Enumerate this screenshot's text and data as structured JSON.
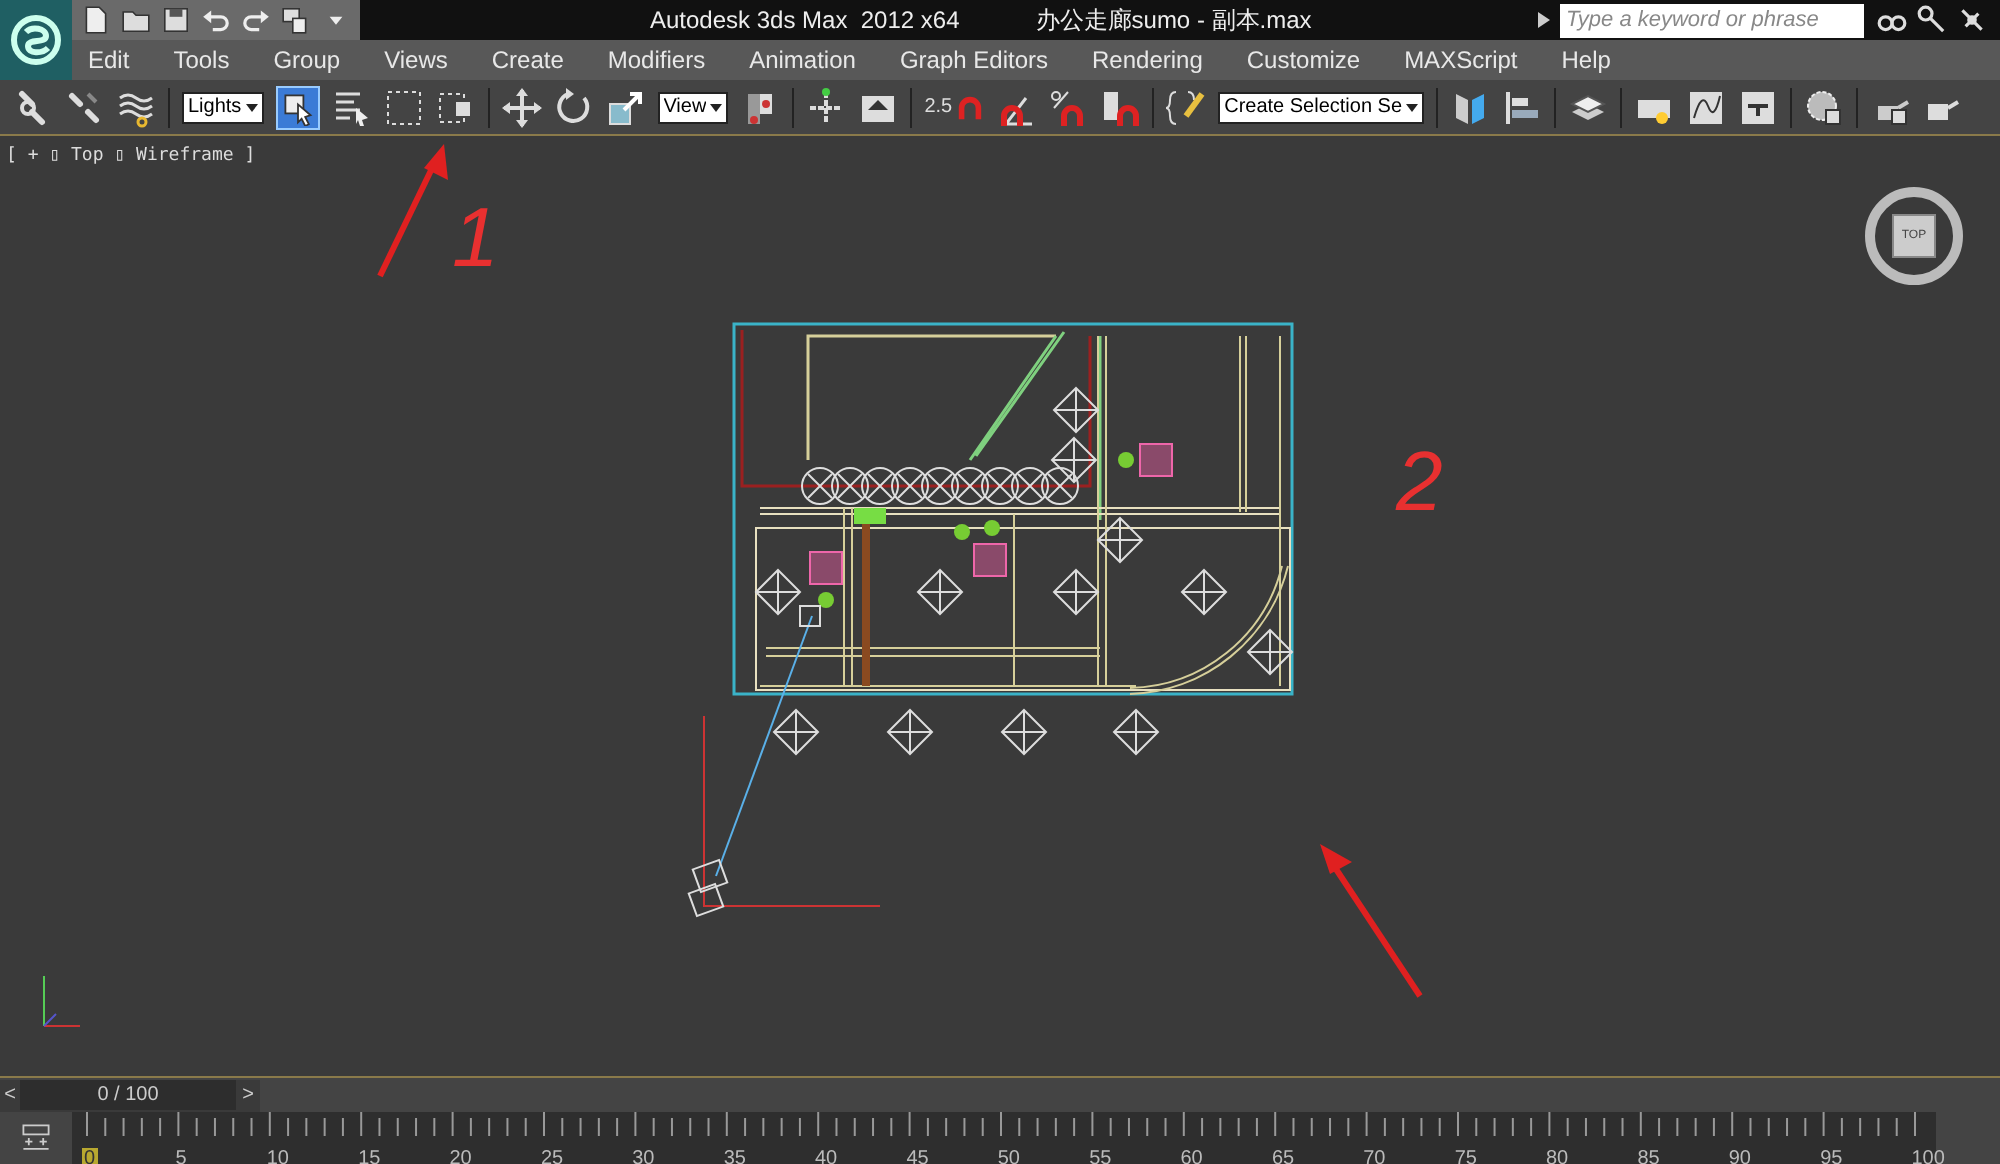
{
  "title_bar": {
    "app_title": "Autodesk 3ds Max  2012 x64",
    "file_name": "办公走廊sumo - 副本.max",
    "search": {
      "placeholder": "Type a keyword or phrase"
    }
  },
  "menu": [
    "Edit",
    "Tools",
    "Group",
    "Views",
    "Create",
    "Modifiers",
    "Animation",
    "Graph Editors",
    "Rendering",
    "Customize",
    "MAXScript",
    "Help"
  ],
  "toolbar": {
    "selection_filter": "Lights",
    "select_object": {
      "selected": true
    },
    "reference_coordinate": "View",
    "named_selection": "Create Selection Se",
    "snap_value": "2.5"
  },
  "viewport": {
    "label": "[ + ▯ Top ▯ Wireframe ]",
    "viewcube": "TOP"
  },
  "annotations": [
    {
      "label": "1"
    },
    {
      "label": "2"
    }
  ],
  "time_slider": {
    "prev": "<",
    "position": "0 / 100",
    "next": ">"
  },
  "track_bar": {
    "ticks": [
      {
        "label": "0",
        "selected": true
      },
      {
        "label": "5",
        "selected": false
      },
      {
        "label": "10",
        "selected": false
      },
      {
        "label": "15",
        "selected": false
      },
      {
        "label": "20",
        "selected": false
      },
      {
        "label": "25",
        "selected": false
      },
      {
        "label": "30",
        "selected": false
      },
      {
        "label": "35",
        "selected": false
      },
      {
        "label": "40",
        "selected": false
      },
      {
        "label": "45",
        "selected": false
      },
      {
        "label": "50",
        "selected": false
      },
      {
        "label": "55",
        "selected": false
      },
      {
        "label": "60",
        "selected": false
      },
      {
        "label": "65",
        "selected": false
      },
      {
        "label": "70",
        "selected": false
      },
      {
        "label": "75",
        "selected": false
      },
      {
        "label": "80",
        "selected": false
      },
      {
        "label": "85",
        "selected": false
      },
      {
        "label": "90",
        "selected": false
      },
      {
        "label": "95",
        "selected": false
      },
      {
        "label": "100",
        "selected": false
      }
    ]
  }
}
